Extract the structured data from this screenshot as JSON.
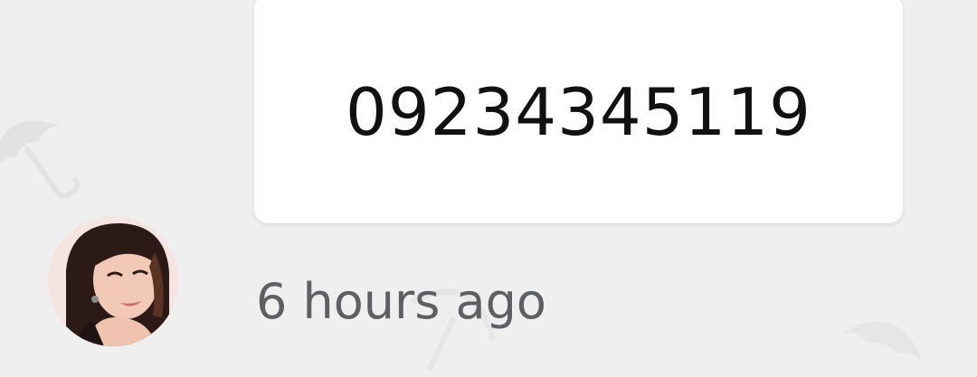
{
  "message": {
    "text": "09234345119"
  },
  "meta": {
    "timestamp": "6 hours ago"
  },
  "avatar": {
    "icon": "user-avatar-photo"
  },
  "colors": {
    "background": "#efefef",
    "bubble": "#ffffff",
    "message_text": "#111111",
    "timestamp_text": "#5e5f62"
  }
}
